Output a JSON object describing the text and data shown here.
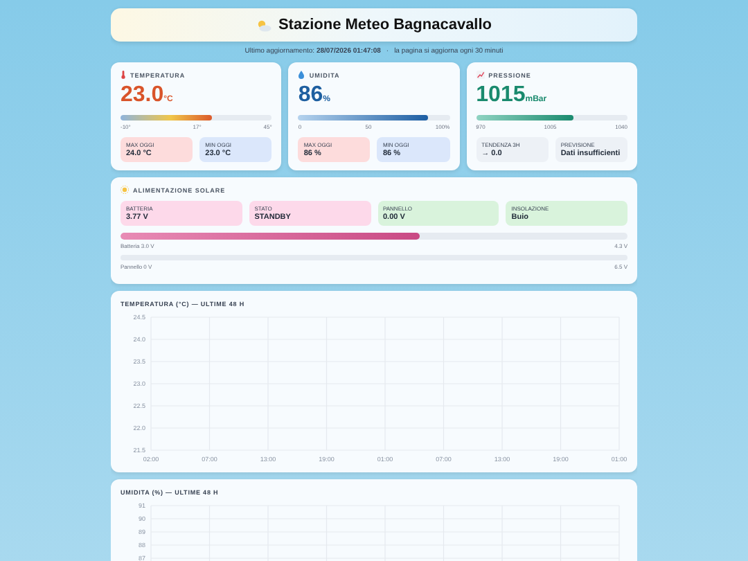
{
  "header": {
    "title": "Stazione Meteo Bagnacavallo"
  },
  "update": {
    "label": "Ultimo aggiornamento:",
    "timestamp": "28/07/2026 01:47:08",
    "separator": "·",
    "note": "la pagina si aggiorna ogni 30 minuti"
  },
  "cards": [
    {
      "kind": "temperature",
      "label": "TEMPERATURA",
      "value": "23.0",
      "unit": "°C",
      "level": 0.6,
      "scale": [
        "-10°",
        "17°",
        "45°"
      ],
      "stats": [
        {
          "label": "MAX OGGI",
          "value": "24.0 °C",
          "color": "#fddcdc"
        },
        {
          "label": "MIN OGGI",
          "value": "23.0 °C",
          "color": "#dbe7fb"
        }
      ]
    },
    {
      "kind": "humidity",
      "label": "UMIDITA",
      "value": "86",
      "unit": "%",
      "level": 0.86,
      "scale": [
        "0",
        "50",
        "100%"
      ],
      "stats": [
        {
          "label": "MAX OGGI",
          "value": "86 %",
          "color": "#fddcdc"
        },
        {
          "label": "MIN OGGI",
          "value": "86 %",
          "color": "#dbe7fb"
        }
      ]
    },
    {
      "kind": "pressure",
      "label": "PRESSIONE",
      "value": "1015",
      "unit": "mBar",
      "level": 0.64,
      "scale": [
        "970",
        "1005",
        "1040"
      ],
      "stats": [
        {
          "label": "TENDENZA 3H",
          "value": "→ 0.0",
          "color": "#edf1f6"
        },
        {
          "label": "PREVISIONE",
          "value": "Dati insufficienti",
          "color": "#edf1f6"
        }
      ]
    }
  ],
  "solar": {
    "label": "ALIMENTAZIONE SOLARE",
    "tiles": [
      {
        "label": "BATTERIA",
        "value": "3.77 V",
        "color": "#fdd9ea"
      },
      {
        "label": "STATO",
        "value": "STANDBY",
        "color": "#fdd9ea"
      },
      {
        "label": "PANNELLO",
        "value": "0.00 V",
        "color": "#d9f3dc"
      },
      {
        "label": "INSOLAZIONE",
        "value": "Buio",
        "color": "#d9f3dc"
      }
    ],
    "bars": [
      {
        "level": 0.59,
        "min": "Batteria 3.0 V",
        "max": "4.3 V"
      },
      {
        "level": 0,
        "min": "Pannello 0 V",
        "max": "6.5 V"
      }
    ]
  },
  "charts": [
    {
      "title": "TEMPERATURA (°C) — ULTIME 48 H",
      "y_labels": [
        "24.5",
        "24.0",
        "23.5",
        "23.0",
        "22.5",
        "22.0",
        "21.5"
      ],
      "x_labels": [
        "02:00",
        "07:00",
        "13:00",
        "19:00",
        "01:00",
        "07:00",
        "13:00",
        "19:00",
        "01:00"
      ]
    },
    {
      "title": "UMIDITA (%) — ULTIME 48 H",
      "y_labels": [
        "91",
        "90",
        "89",
        "88",
        "87"
      ]
    }
  ]
}
